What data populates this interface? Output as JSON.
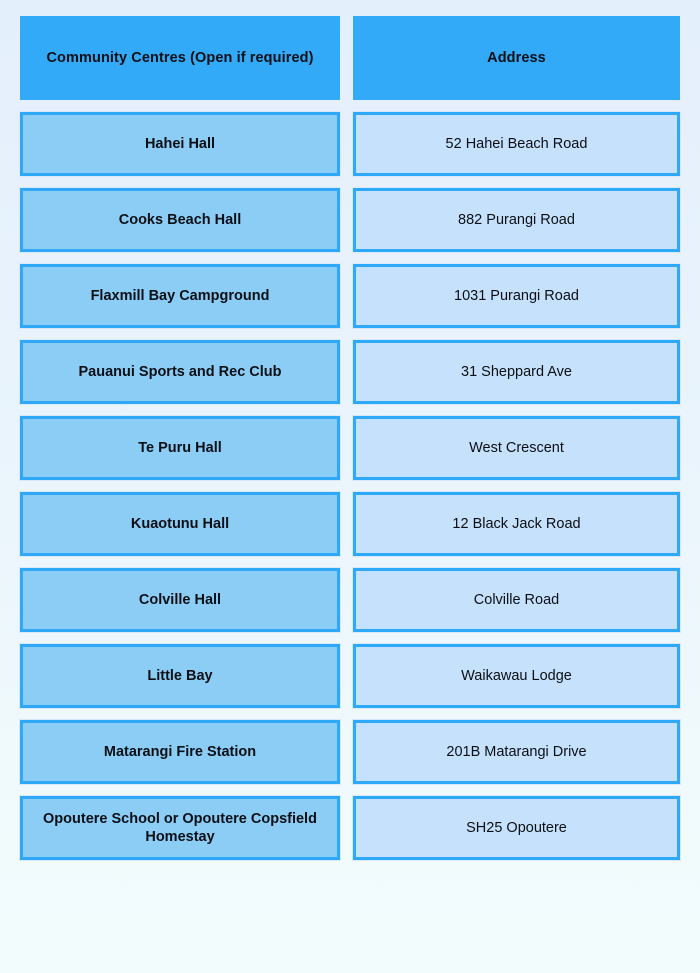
{
  "table": {
    "columns": [
      {
        "key": "name",
        "header": "Community Centres (Open if required)"
      },
      {
        "key": "address",
        "header": "Address"
      }
    ],
    "rows": [
      {
        "name": "Hahei Hall",
        "address": "52 Hahei Beach Road"
      },
      {
        "name": "Cooks Beach Hall",
        "address": "882 Purangi Road"
      },
      {
        "name": "Flaxmill Bay Campground",
        "address": "1031 Purangi Road"
      },
      {
        "name": "Pauanui Sports and Rec Club",
        "address": "31 Sheppard Ave"
      },
      {
        "name": "Te Puru Hall",
        "address": "West Crescent"
      },
      {
        "name": "Kuaotunu Hall",
        "address": "12 Black Jack Road"
      },
      {
        "name": "Colville Hall",
        "address": "Colville Road"
      },
      {
        "name": "Little Bay",
        "address": "Waikawau Lodge"
      },
      {
        "name": "Matarangi Fire Station",
        "address": "201B Matarangi Drive"
      },
      {
        "name": "Opoutere School or Opoutere Copsfield Homestay",
        "address": "SH25 Opoutere"
      }
    ]
  },
  "colors": {
    "header_fill": "#33aaf8",
    "name_fill": "#8ccdf6",
    "address_fill": "#c6e1fb",
    "cell_border": "#2ea9f7",
    "text": "#0c1016",
    "page_background_top": "#e4effc",
    "page_background_bottom": "#f3fcfd"
  }
}
